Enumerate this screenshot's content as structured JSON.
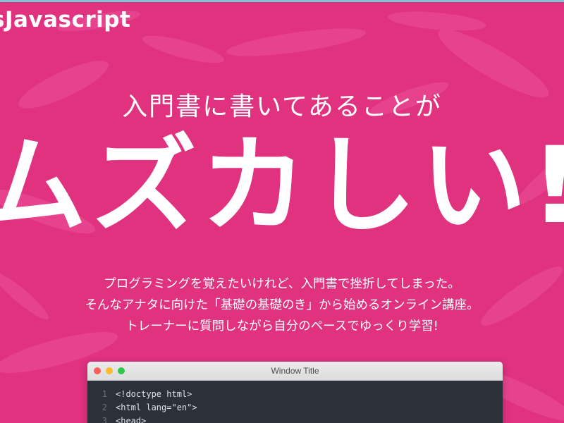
{
  "header": {
    "logo_text": "sJavascript"
  },
  "hero": {
    "subtitle": "入門書に書いてあることが",
    "headline": "ムズカしい!",
    "description": [
      "プログラミングを覚えたいけれど、入門書で挫折してしまった。",
      "そんなアナタに向けた「基礎の基礎のき」から始めるオンライン講座。",
      "トレーナーに質問しながら自分のペースでゆっくり学習!"
    ]
  },
  "code_window": {
    "title": "Window Title",
    "lines": [
      {
        "number": "1",
        "code": "<!doctype html>"
      },
      {
        "number": "2",
        "code": "<html lang=\"en\">"
      },
      {
        "number": "3",
        "code": "<head>"
      }
    ]
  },
  "colors": {
    "background": "#e0327f",
    "top_strip": "#7fc4d6",
    "editor_bg": "#2b3039"
  }
}
